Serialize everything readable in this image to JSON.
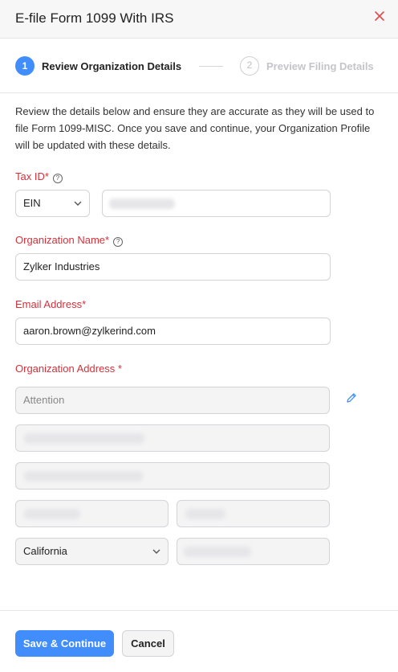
{
  "header": {
    "title": "E-file Form 1099 With IRS"
  },
  "stepper": {
    "steps": [
      {
        "number": "1",
        "label": "Review Organization Details"
      },
      {
        "number": "2",
        "label": "Preview Filing Details"
      }
    ]
  },
  "description": "Review the details below and ensure they are accurate as they will be used to file Form 1099-MISC. Once you save and continue, your Organization Profile will be updated with these details.",
  "form": {
    "tax_id": {
      "label": "Tax ID*",
      "type_value": "EIN"
    },
    "org_name": {
      "label": "Organization Name*",
      "value": "Zylker Industries"
    },
    "email": {
      "label": "Email Address*",
      "value": "aaron.brown@zylkerind.com"
    },
    "address": {
      "label": "Organization Address *",
      "attention_placeholder": "Attention",
      "state_value": "California"
    }
  },
  "footer": {
    "save_label": "Save & Continue",
    "cancel_label": "Cancel"
  },
  "colors": {
    "accent": "#408dfb",
    "required_label": "#d6303a"
  },
  "icons": {
    "close": "close-icon",
    "edit": "pencil-icon",
    "help": "help-circle-icon",
    "dropdown": "chevron-down-icon"
  }
}
